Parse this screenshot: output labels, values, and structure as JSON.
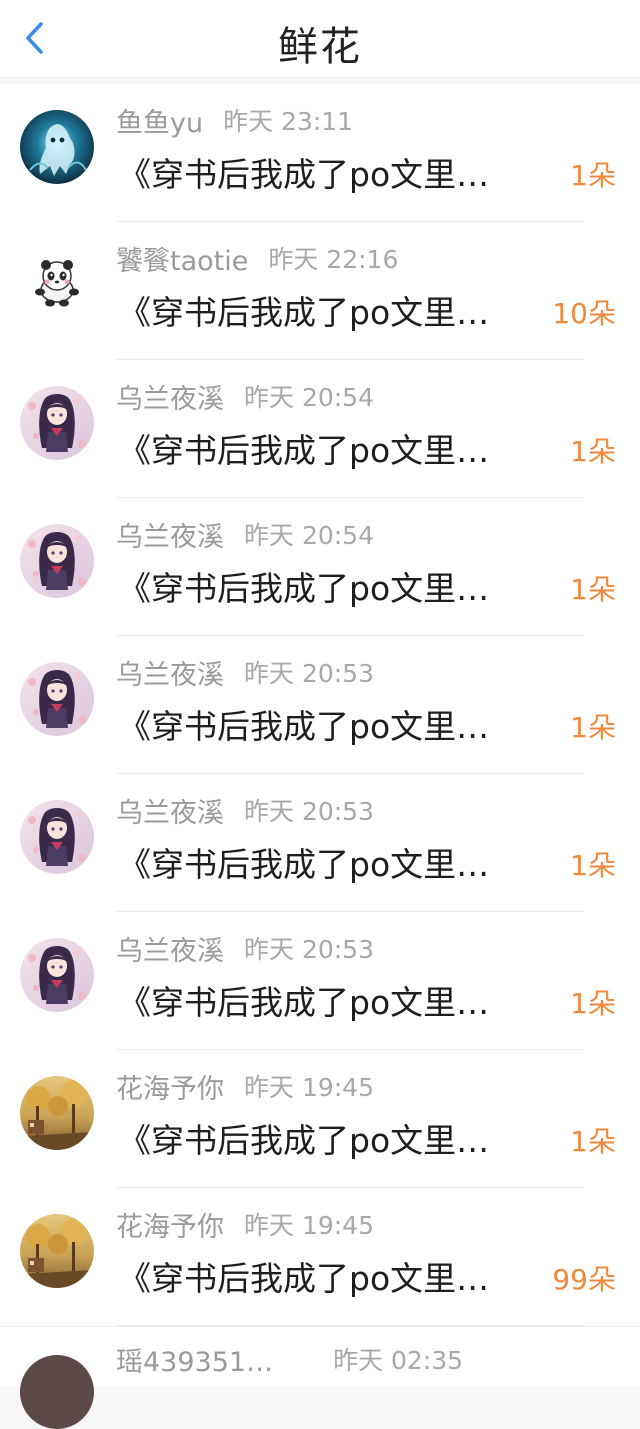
{
  "header": {
    "title": "鲜花"
  },
  "icons": {
    "back": "chevron-left-icon"
  },
  "colors": {
    "accent": "#3a8ee6",
    "count": "#ef8a3c"
  },
  "items": [
    {
      "name": "鱼鱼yu",
      "time": "昨天 23:11",
      "book": "《穿书后我成了po文里…",
      "count": "1朵",
      "avatar": "blue-ghost"
    },
    {
      "name": "饕餮taotie",
      "time": "昨天 22:16",
      "book": "《穿书后我成了po文里…",
      "count": "10朵",
      "avatar": "panda"
    },
    {
      "name": "乌兰夜溪",
      "time": "昨天 20:54",
      "book": "《穿书后我成了po文里…",
      "count": "1朵",
      "avatar": "anime-girl"
    },
    {
      "name": "乌兰夜溪",
      "time": "昨天 20:54",
      "book": "《穿书后我成了po文里…",
      "count": "1朵",
      "avatar": "anime-girl"
    },
    {
      "name": "乌兰夜溪",
      "time": "昨天 20:53",
      "book": "《穿书后我成了po文里…",
      "count": "1朵",
      "avatar": "anime-girl"
    },
    {
      "name": "乌兰夜溪",
      "time": "昨天 20:53",
      "book": "《穿书后我成了po文里…",
      "count": "1朵",
      "avatar": "anime-girl"
    },
    {
      "name": "乌兰夜溪",
      "time": "昨天 20:53",
      "book": "《穿书后我成了po文里…",
      "count": "1朵",
      "avatar": "anime-girl"
    },
    {
      "name": "花海予你",
      "time": "昨天 19:45",
      "book": "《穿书后我成了po文里…",
      "count": "1朵",
      "avatar": "autumn-street"
    },
    {
      "name": "花海予你",
      "time": "昨天 19:45",
      "book": "《穿书后我成了po文里…",
      "count": "99朵",
      "avatar": "autumn-street"
    }
  ],
  "partial_item": {
    "name": "瑶439351…",
    "time": "昨天 02:35"
  }
}
